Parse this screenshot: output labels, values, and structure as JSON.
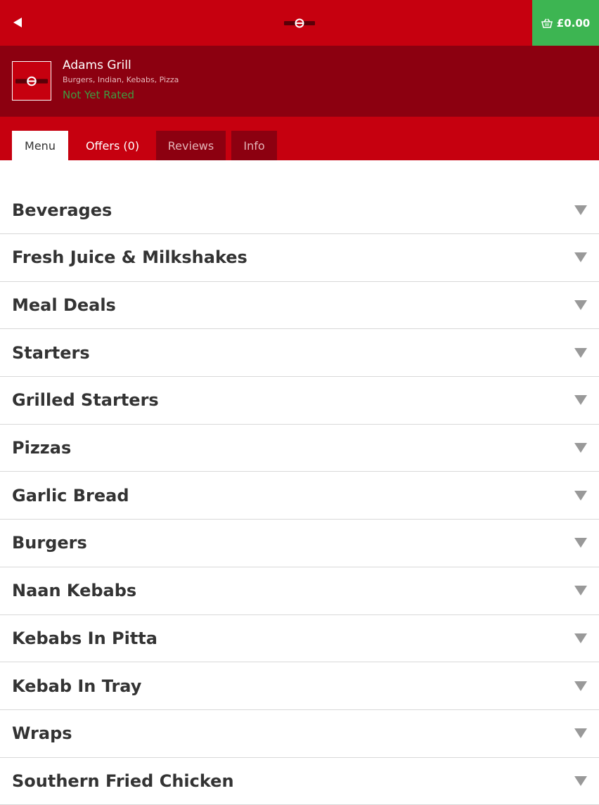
{
  "header": {
    "basket_total": "£0.00"
  },
  "restaurant": {
    "name": "Adams Grill",
    "cuisines": "Burgers, Indian, Kebabs, Pizza",
    "rating_text": "Not Yet Rated"
  },
  "tabs": [
    {
      "label": "Menu",
      "active": true
    },
    {
      "label": "Offers (0)",
      "active": false
    },
    {
      "label": "Reviews",
      "active": false
    },
    {
      "label": "Info",
      "active": false
    }
  ],
  "menu": {
    "categories": [
      "Beverages",
      "Fresh Juice & Milkshakes",
      "Meal Deals",
      "Starters",
      "Grilled Starters",
      "Pizzas",
      "Garlic Bread",
      "Burgers",
      "Naan Kebabs",
      "Kebabs In Pitta",
      "Kebab In Tray",
      "Wraps",
      "Southern Fried Chicken"
    ]
  },
  "colors": {
    "brand_red": "#c6000f",
    "dark_red": "#8c0010",
    "basket_green": "#3db552",
    "rating_green": "#3e9c41"
  },
  "icons": {
    "back": "back-arrow-icon",
    "basket": "basket-icon",
    "expand": "chevron-down-icon"
  }
}
